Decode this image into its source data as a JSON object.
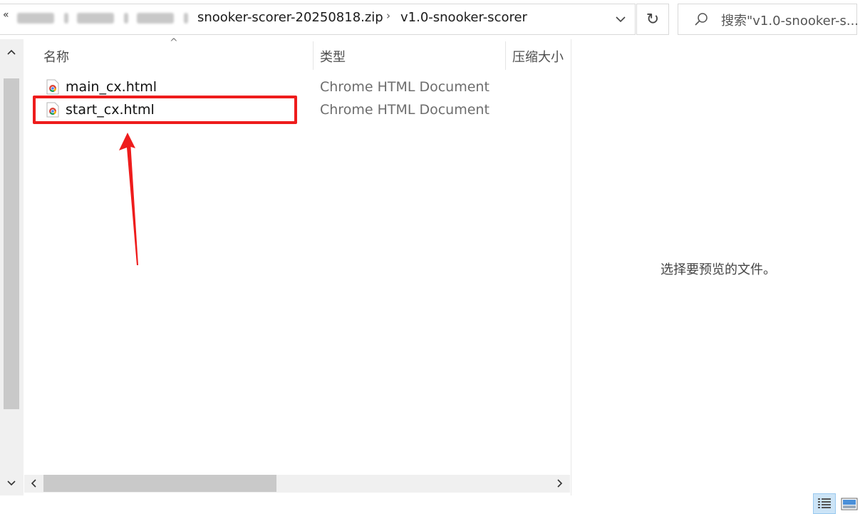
{
  "address_bar": {
    "more_glyph": "«",
    "separator_glyph": "›",
    "crumbs": [
      "snooker-scorer-20250818.zip",
      "v1.0-snooker-scorer"
    ],
    "refresh_glyph": "↻"
  },
  "search": {
    "placeholder": "搜索\"v1.0-snooker-s..."
  },
  "file_list": {
    "sort_indicator": "^",
    "columns": {
      "name": "名称",
      "type": "类型",
      "compressed_size": "压缩大小"
    },
    "files": [
      {
        "name": "main_cx.html",
        "type": "Chrome HTML Document",
        "icon": "chrome-html-file-icon",
        "highlighted": false
      },
      {
        "name": "start_cx.html",
        "type": "Chrome HTML Document",
        "icon": "chrome-html-file-icon",
        "highlighted": true
      }
    ]
  },
  "preview_pane": {
    "message": "选择要预览的文件。"
  },
  "annotation": {
    "highlight_color": "#ee1c1c",
    "arrow_color": "#ee1c1c"
  },
  "view_toggles": [
    "details-view-icon",
    "large-icons-view-icon"
  ]
}
